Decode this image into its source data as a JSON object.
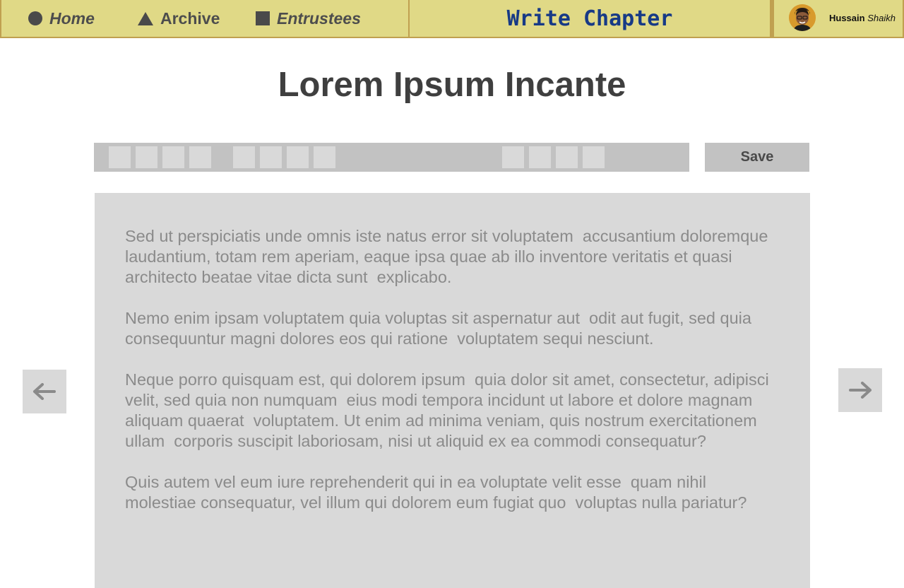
{
  "nav": {
    "home_label": "Home",
    "archive_label": "Archive",
    "entrustees_label": "Entrustees",
    "title": "Write Chapter",
    "user_first": "Hussain",
    "user_last": "Shaikh"
  },
  "page": {
    "title": "Lorem Ipsum Incante"
  },
  "toolbar": {
    "save_label": "Save"
  },
  "editor": {
    "paragraphs": [
      "Sed ut perspiciatis unde omnis iste natus error sit voluptatem  accusantium doloremque laudantium, totam rem aperiam, eaque ipsa quae ab illo inventore veritatis et quasi architecto beatae vitae dicta sunt  explicabo.",
      "Nemo enim ipsam voluptatem quia voluptas sit aspernatur aut  odit aut fugit, sed quia consequuntur magni dolores eos qui ratione  voluptatem sequi nesciunt.",
      "Neque porro quisquam est, qui dolorem ipsum  quia dolor sit amet, consectetur, adipisci velit, sed quia non numquam  eius modi tempora incidunt ut labore et dolore magnam aliquam quaerat  voluptatem. Ut enim ad minima veniam, quis nostrum exercitationem ullam  corporis suscipit laboriosam, nisi ut aliquid ex ea commodi consequatur?",
      "Quis autem vel eum iure reprehenderit qui in ea voluptate velit esse  quam nihil molestiae consequatur, vel illum qui dolorem eum fugiat quo  voluptas nulla pariatur?"
    ]
  },
  "icons": {
    "home": "circle-icon",
    "archive": "triangle-icon",
    "entrustees": "square-icon",
    "prev": "arrow-left-icon",
    "next": "arrow-right-icon"
  },
  "colors": {
    "nav_bg": "#e0d986",
    "nav_border": "#c0a050",
    "title_blue": "#173a86",
    "panel_gray": "#d9d9d9",
    "toolbar_gray": "#c2c2c2",
    "body_text": "#8b8b8b"
  }
}
